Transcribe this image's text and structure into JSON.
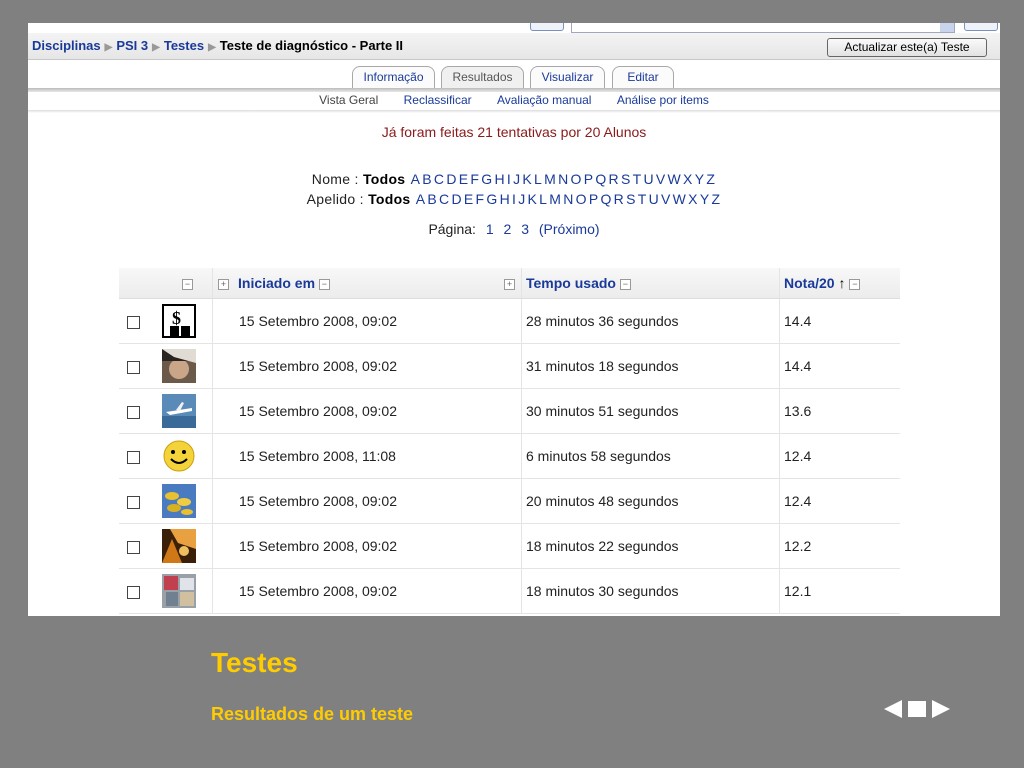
{
  "breadcrumb": {
    "items": [
      {
        "label": "Disciplinas",
        "link": true
      },
      {
        "label": "PSI 3",
        "link": true
      },
      {
        "label": "Testes",
        "link": true
      },
      {
        "label": "Teste de diagnóstico - Parte II",
        "link": false
      }
    ],
    "separator": "▶"
  },
  "update_button": "Actualizar este(a) Teste",
  "tabs": [
    "Informação",
    "Resultados",
    "Visualizar",
    "Editar"
  ],
  "selected_tab": "Resultados",
  "subtabs": [
    "Vista Geral",
    "Reclassificar",
    "Avaliação manual",
    "Análise por items"
  ],
  "attempts_text": "Já foram feitas 21 tentativas por 20 Alunos",
  "filter": {
    "first_name_label": "Nome :",
    "last_name_label": "Apelido :",
    "all_label": "Todos",
    "letters": [
      "A",
      "B",
      "C",
      "D",
      "E",
      "F",
      "G",
      "H",
      "I",
      "J",
      "K",
      "L",
      "M",
      "N",
      "O",
      "P",
      "Q",
      "R",
      "S",
      "T",
      "U",
      "V",
      "W",
      "X",
      "Y",
      "Z"
    ]
  },
  "pager": {
    "label": "Página:",
    "pages": [
      "1",
      "2",
      "3"
    ],
    "next": "(Próximo)"
  },
  "table": {
    "headers": {
      "started": "Iniciado em",
      "time": "Tempo usado",
      "grade": "Nota/20",
      "sort_arrow": "↑"
    },
    "rows": [
      {
        "started": "15 Setembro 2008, 09:02",
        "time": "28 minutos 36 segundos",
        "grade": "14.4",
        "avatar": "dollar-man"
      },
      {
        "started": "15 Setembro 2008, 09:02",
        "time": "31 minutos 18 segundos",
        "grade": "14.4",
        "avatar": "face-photo"
      },
      {
        "started": "15 Setembro 2008, 09:02",
        "time": "30 minutos 51 segundos",
        "grade": "13.6",
        "avatar": "airplane"
      },
      {
        "started": "15 Setembro 2008, 11:08",
        "time": "6 minutos 58 segundos",
        "grade": "12.4",
        "avatar": "smiley"
      },
      {
        "started": "15 Setembro 2008, 09:02",
        "time": "20 minutos 48 segundos",
        "grade": "12.4",
        "avatar": "coins"
      },
      {
        "started": "15 Setembro 2008, 09:02",
        "time": "18 minutos 22 segundos",
        "grade": "12.2",
        "avatar": "orange-photo"
      },
      {
        "started": "15 Setembro 2008, 09:02",
        "time": "18 minutos 30 segundos",
        "grade": "12.1",
        "avatar": "collage-photo"
      }
    ]
  },
  "slide": {
    "title": "Testes",
    "subtitle": "Resultados de um teste"
  },
  "colors": {
    "slide_bg": "#808080",
    "caption": "#ffcc00",
    "link": "#1a3a9a",
    "attempts": "#8a1a1a"
  }
}
